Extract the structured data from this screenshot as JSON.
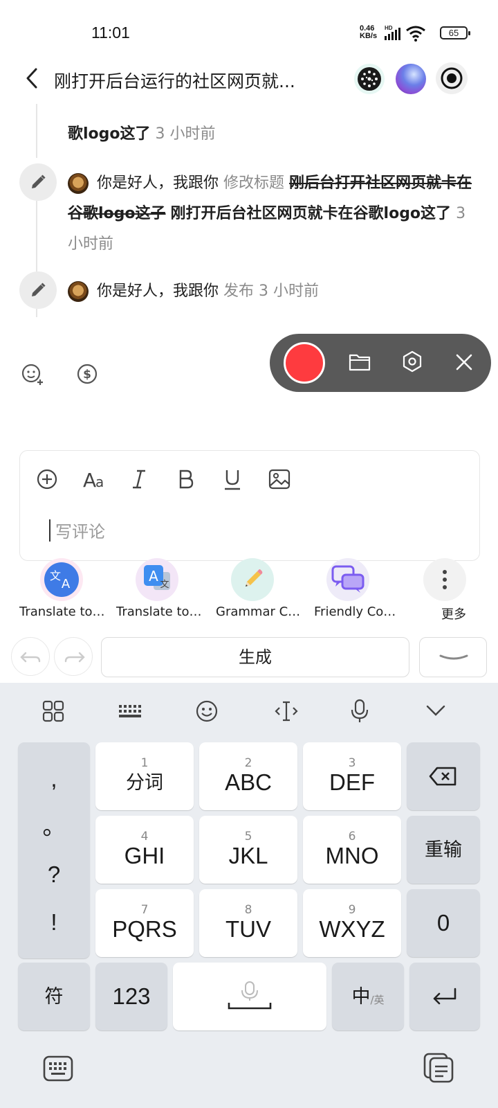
{
  "status_bar": {
    "time": "11:01",
    "speed_value": "0.46",
    "speed_unit": "KB/s",
    "hd": "HD",
    "battery": "65"
  },
  "header": {
    "title": "刚打开后台运行的社区网页就..."
  },
  "activity": {
    "partial_text": "歌logo这了",
    "partial_time": "3 小时前",
    "item1": {
      "user": "你是好人，我跟你",
      "action": "修改标题",
      "old_title": "刚后台打开社区网页就卡在谷歌logo这子",
      "new_title": "刚打开后台社区网页就卡在谷歌logo这了",
      "time": "3 小时前"
    },
    "item2": {
      "user": "你是好人，我跟你",
      "action": "发布",
      "time": "3 小时前"
    }
  },
  "editor": {
    "placeholder": "写评论"
  },
  "ai_tools": [
    {
      "label": "Translate to…"
    },
    {
      "label": "Translate to…"
    },
    {
      "label": "Grammar C…"
    },
    {
      "label": "Friendly Co…"
    },
    {
      "label": "更多"
    }
  ],
  "generate_label": "生成",
  "keyboard": {
    "left_col": [
      ",",
      "。",
      "?",
      "!"
    ],
    "rows": [
      [
        {
          "num": "1",
          "label": "分词"
        },
        {
          "num": "2",
          "label": "ABC"
        },
        {
          "num": "3",
          "label": "DEF"
        }
      ],
      [
        {
          "num": "4",
          "label": "GHI"
        },
        {
          "num": "5",
          "label": "JKL"
        },
        {
          "num": "6",
          "label": "MNO"
        }
      ],
      [
        {
          "num": "7",
          "label": "PQRS"
        },
        {
          "num": "8",
          "label": "TUV"
        },
        {
          "num": "9",
          "label": "WXYZ"
        }
      ]
    ],
    "retype": "重输",
    "zero": "0",
    "symbols": "符",
    "numbers": "123",
    "lang_main": "中",
    "lang_sub": "/英"
  },
  "colors": {
    "record_red": "#fe3b3f",
    "recorder_bg": "#595959",
    "keyboard_bg": "#eaedf1",
    "translate_blue": "#3f7be6",
    "friendly_purple": "#7b5cf0"
  }
}
